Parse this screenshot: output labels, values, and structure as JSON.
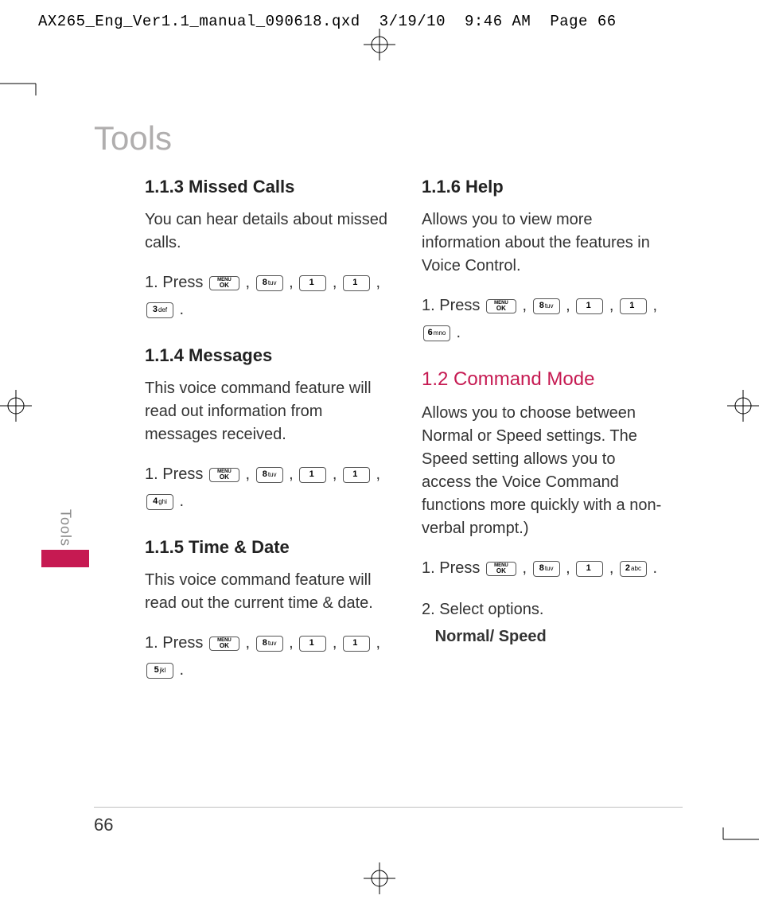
{
  "slug": {
    "file": "AX265_Eng_Ver1.1_manual_090618.qxd",
    "date": "3/19/10",
    "time": "9:46 AM",
    "page_label": "Page 66"
  },
  "page_title": "Tools",
  "side_tab": "Tools",
  "page_number": "66",
  "left": {
    "s113": {
      "heading": "1.1.3 Missed Calls",
      "body": "You can hear details about missed calls.",
      "step_prefix": "1. Press ",
      "keys": [
        "OK",
        "8",
        "1",
        "1",
        "3"
      ]
    },
    "s114": {
      "heading": "1.1.4 Messages",
      "body": "This voice command feature will read out information from messages received.",
      "step_prefix": "1. Press ",
      "keys": [
        "OK",
        "8",
        "1",
        "1",
        "4"
      ]
    },
    "s115": {
      "heading": "1.1.5 Time & Date",
      "body": "This voice command feature will read out the current time & date.",
      "step_prefix": "1. Press ",
      "keys": [
        "OK",
        "8",
        "1",
        "1",
        "5"
      ]
    }
  },
  "right": {
    "s116": {
      "heading": "1.1.6 Help",
      "body": "Allows you to view more information about the features in Voice Control.",
      "step_prefix": "1. Press ",
      "keys": [
        "OK",
        "8",
        "1",
        "1",
        "6"
      ]
    },
    "s12": {
      "heading": "1.2 Command Mode",
      "body": "Allows you to choose between Normal or Speed settings. The Speed setting allows you to access the Voice Command functions more quickly with a non-verbal prompt.)",
      "step1_prefix": "1. Press ",
      "keys": [
        "OK",
        "8",
        "1",
        "2"
      ],
      "step2": "2. Select options.",
      "step2_bold": "Normal/ Speed"
    }
  },
  "key_labels": {
    "OK": "OK",
    "1": "1",
    "2": "2 abc",
    "3": "3 def",
    "4": "4 ghi",
    "5": "5 jkl",
    "6": "6 mno",
    "8": "8 tuv"
  }
}
